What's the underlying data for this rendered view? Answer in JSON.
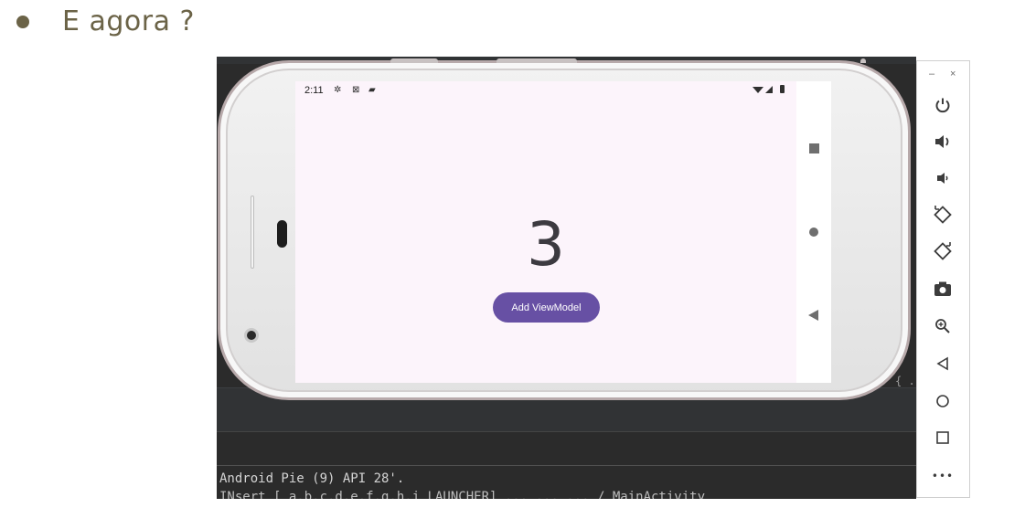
{
  "slide": {
    "bullet_text": "E agora ?"
  },
  "ide": {
    "console_line_1": "Android Pie (9) API 28'.",
    "console_line_2": "INsert [  a.b.c.d.e.f.g.h.i  LAUNCHER]  ...  ...  ...  / MainActivity",
    "brace_text": "{ ."
  },
  "phone": {
    "status_time": "2:11",
    "status_icons": [
      "settings-icon",
      "sim-icon",
      "sd-card-icon"
    ],
    "counter_value": "3",
    "add_button_label": "Add ViewModel"
  },
  "nav_bar": {
    "icons": [
      "recents-square-icon",
      "home-circle-icon",
      "back-triangle-icon"
    ]
  },
  "toolbar": {
    "minimize_label": "–",
    "close_label": "×",
    "buttons": [
      {
        "name": "power-icon",
        "glyph": "⏻"
      },
      {
        "name": "volume-up-icon",
        "glyph": "🔊"
      },
      {
        "name": "volume-down-icon",
        "glyph": "🔉"
      },
      {
        "name": "rotate-left-icon",
        "glyph": "◇"
      },
      {
        "name": "rotate-right-icon",
        "glyph": "◇"
      },
      {
        "name": "screenshot-camera-icon",
        "glyph": "◙"
      },
      {
        "name": "zoom-icon",
        "glyph": "⊕"
      },
      {
        "name": "back-icon",
        "glyph": "◁"
      },
      {
        "name": "home-icon",
        "glyph": "○"
      },
      {
        "name": "overview-icon",
        "glyph": "□"
      },
      {
        "name": "more-icon",
        "glyph": "•••"
      }
    ]
  },
  "colors": {
    "accent_button": "#6750a4",
    "screen_bg": "#fcf4fb",
    "slide_text": "#6b6347"
  }
}
